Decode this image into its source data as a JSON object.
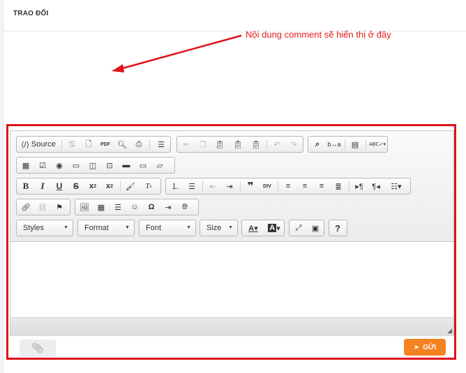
{
  "panel": {
    "title": "TRAO ĐỔI"
  },
  "annotation": {
    "text": "Nội dung comment sẽ hiển thị ở đây"
  },
  "toolbar": {
    "source_label": "Source",
    "styles_label": "Styles",
    "format_label": "Format",
    "font_label": "Font",
    "size_label": "Size",
    "buttons": {
      "save": "save-icon",
      "new_page": "new-page-icon",
      "export_pdf": "pdf-icon",
      "preview": "preview-icon",
      "print": "print-icon",
      "templates": "templates-icon",
      "cut": "cut-icon",
      "copy": "copy-icon",
      "paste": "paste-icon",
      "paste_text": "paste-text-icon",
      "paste_word": "paste-word-icon",
      "undo": "undo-icon",
      "redo": "redo-icon",
      "find": "find-icon",
      "replace": "replace-icon",
      "select_all": "select-all-icon",
      "spellcheck": "spellcheck-icon"
    }
  },
  "footer": {
    "send_label": "GỬI"
  },
  "colors": {
    "accent": "#f58220",
    "annotation": "#e0111a"
  }
}
